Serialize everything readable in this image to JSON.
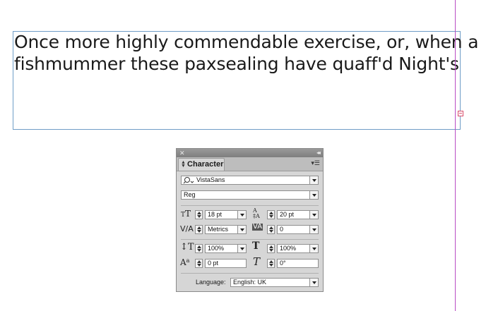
{
  "document": {
    "lines": [
      "Once more highly commendable exercise, or, when a",
      "fishmummer these paxsealing have quaff'd Night's"
    ]
  },
  "panel": {
    "close_glyph": "✕",
    "collapse_glyph": "◂◂",
    "tab_label": "Character",
    "menu_glyph": "▾☰",
    "font_family": "VistaSans",
    "font_style": "Reg",
    "font_size": "18 pt",
    "leading": "20 pt",
    "kerning": "Metrics",
    "tracking": "0",
    "vertical_scale": "100%",
    "horizontal_scale": "100%",
    "baseline_shift": "0 pt",
    "skew": "0°",
    "language_label": "Language:",
    "language": "English: UK"
  },
  "icons": {
    "font_size": "tT",
    "leading": "A/A",
    "kerning": "V/A",
    "tracking": "VA",
    "vertical_scale": "IT",
    "horizontal_scale": "T",
    "baseline_shift": "Aa",
    "skew": "T"
  },
  "colors": {
    "frame_border": "#6f9dc7",
    "guide": "#b94cc4",
    "outport": "#d84c6a",
    "panel_bg": "#d6d6d6"
  }
}
